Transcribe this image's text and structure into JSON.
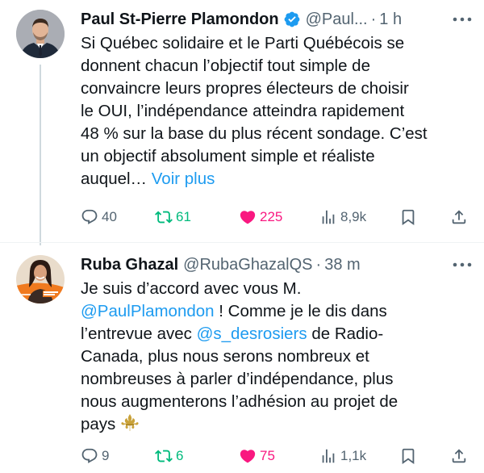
{
  "tweets": [
    {
      "display_name": "Paul St-Pierre Plamondon",
      "verified": true,
      "handle": "@Paul...",
      "separator": "·",
      "time": "1 h",
      "text_lines": [
        "Si Québec solidaire et le Parti Québécois se",
        "donnent chacun l’objectif tout simple de",
        "convaincre leurs propres électeurs de choisir",
        "le OUI, l’indépendance atteindra rapidement",
        "48 % sur la base du plus récent sondage. C’est",
        "un objectif absolument simple et réaliste",
        "auquel…"
      ],
      "see_more": "Voir plus",
      "replies": "40",
      "retweets": "61",
      "likes": "225",
      "views": "8,9k",
      "liked": true,
      "retweeted": true
    },
    {
      "display_name": "Ruba Ghazal",
      "verified": false,
      "handle": "@RubaGhazalQS",
      "separator": "·",
      "time": "38 m",
      "line1": "Je suis d’accord avec vous M.",
      "mention1": "@PaulPlamondon",
      "line2_rest": " ! Comme je le dis dans",
      "line3_pre": "l’entrevue avec ",
      "mention2": "@s_desrosiers",
      "line3_post": " de Radio-",
      "line4": "Canada, plus nous serons nombreux et",
      "line5": "nombreuses à parler d’indépendance, plus",
      "line6": "nous augmenterons l’adhésion au projet de",
      "line7": "pays ",
      "emoji_name": "fleur-de-lis-icon",
      "replies": "9",
      "retweets": "6",
      "likes": "75",
      "views": "1,1k",
      "liked": true,
      "retweeted": true
    }
  ],
  "colors": {
    "text": "#0f1419",
    "secondary": "#536471",
    "link": "#1d9bf0",
    "retweet_active": "#00ba7c",
    "like_active": "#f91880",
    "verified_badge": "#1d9bf0",
    "thread_line": "#cfd9de"
  }
}
